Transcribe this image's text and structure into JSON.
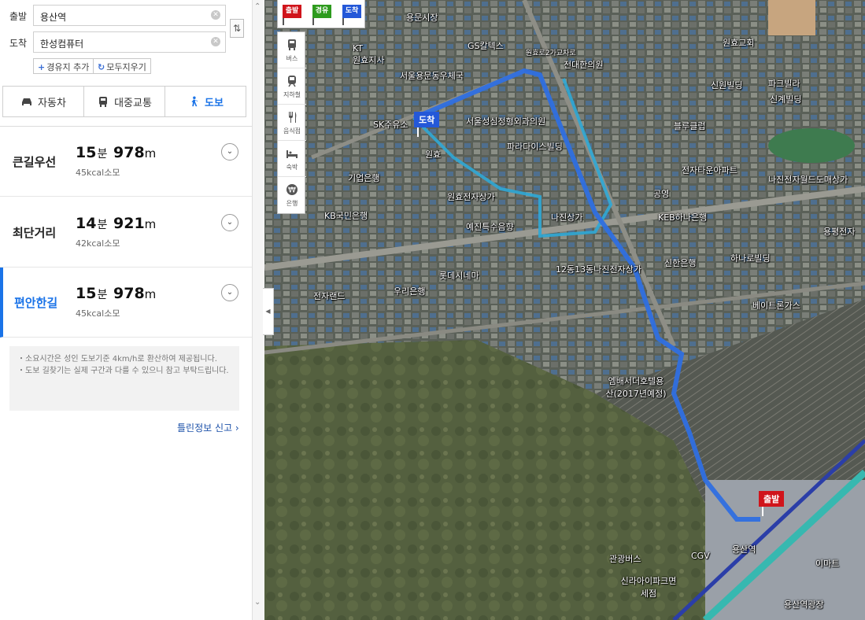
{
  "search": {
    "origin_label": "출발",
    "origin_value": "용산역",
    "destination_label": "도착",
    "destination_value": "한성컴퓨터",
    "add_waypoint": "경유지 추가",
    "clear_all": "모두지우기"
  },
  "modes": [
    {
      "label": "자동차",
      "icon": "car-icon"
    },
    {
      "label": "대중교통",
      "icon": "bus-icon"
    },
    {
      "label": "도보",
      "icon": "walk-icon",
      "active": true
    }
  ],
  "routes": [
    {
      "name": "큰길우선",
      "minutes": "15",
      "minutes_unit": "분",
      "distance": "978",
      "distance_unit": "m",
      "kcal": "45kcal소모"
    },
    {
      "name": "최단거리",
      "minutes": "14",
      "minutes_unit": "분",
      "distance": "921",
      "distance_unit": "m",
      "kcal": "42kcal소모"
    },
    {
      "name": "편안한길",
      "minutes": "15",
      "minutes_unit": "분",
      "distance": "978",
      "distance_unit": "m",
      "kcal": "45kcal소모",
      "active": true
    }
  ],
  "notice": {
    "line1": "・소요시간은 성인 도보기준 4km/h로 환산하여 제공됩니다.",
    "line2": "・도보 길찾기는 실제 구간과 다를 수 있으니 참고 부탁드립니다."
  },
  "report_link": "틀린정보 신고",
  "map_toolbox": {
    "flags": [
      {
        "label": "출발",
        "color": "#d0141b"
      },
      {
        "label": "경유",
        "color": "#2e9b1e"
      },
      {
        "label": "도착",
        "color": "#2458d8"
      }
    ],
    "categories": [
      {
        "label": "버스",
        "icon": "bus-icon"
      },
      {
        "label": "지하철",
        "icon": "subway-icon"
      },
      {
        "label": "음식점",
        "icon": "restaurant-icon"
      },
      {
        "label": "숙박",
        "icon": "bed-icon"
      },
      {
        "label": "은행",
        "icon": "bank-icon"
      }
    ]
  },
  "map": {
    "start_marker": "출발",
    "end_marker": "도착",
    "route_color": "#2f6fe0",
    "labels": [
      "용문시장",
      "GS칼텍스",
      "원효교회",
      "KT",
      "원효지사",
      "원효로2가교차로",
      "전대한의원",
      "서울용문동우체국",
      "신원빌딩",
      "파크빌라",
      "신계빌딩",
      "SK주유소",
      "서울성심정형외과의원",
      "블루클럽",
      "파라다이스빌딩",
      "전자타운아파트",
      "공영",
      "나진전자월드도매상가",
      "원효",
      "기업은행",
      "원효전자상가",
      "나진상가",
      "KEB하나은행",
      "KB국민은행",
      "예진특수음향",
      "용평전자",
      "신한은행",
      "하나로빌딩",
      "12동13동나진전자상가",
      "롯데시네마",
      "전자랜드",
      "우리은행",
      "베이트론가스",
      "엠배서더호텔용산(2017년예정)",
      "관광버스",
      "CGV",
      "신라아이파크면세점",
      "이마트",
      "용산역광장",
      "용산역"
    ]
  }
}
